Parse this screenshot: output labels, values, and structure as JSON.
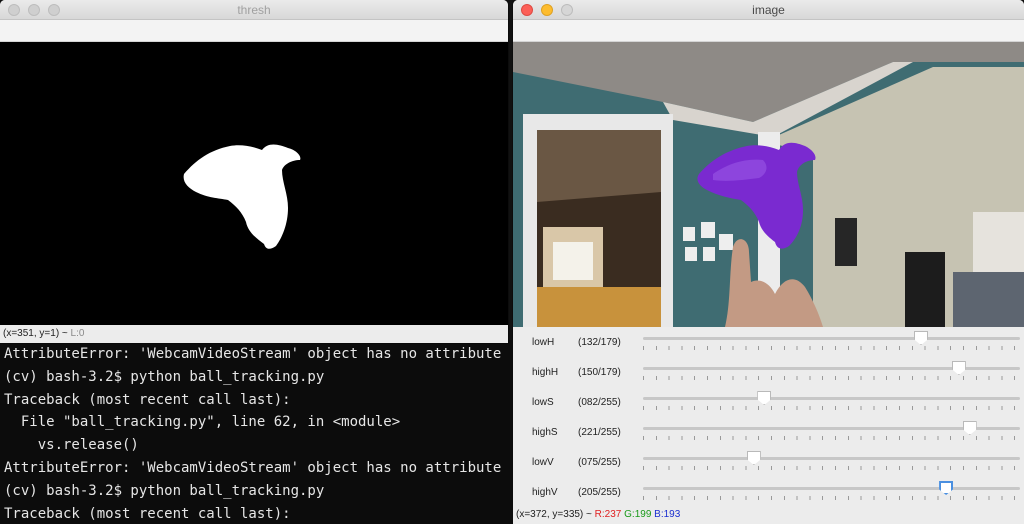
{
  "terminal": {
    "lines": [
      "AttributeError: 'WebcamVideoStream' object has no attribute",
      "(cv) bash-3.2$ python ball_tracking.py",
      "Traceback (most recent call last):",
      "  File \"ball_tracking.py\", line 62, in <module>",
      "    vs.release()",
      "AttributeError: 'WebcamVideoStream' object has no attribute",
      "(cv) bash-3.2$ python ball_tracking.py",
      "Traceback (most recent call last):"
    ]
  },
  "thresh_window": {
    "title": "thresh",
    "status_coords": "(x=351, y=1) ~",
    "status_level": "L:0"
  },
  "image_window": {
    "title": "image",
    "status_coords": "(x=372, y=335) ~",
    "r": "R:237",
    "g": "G:199",
    "b": "B:193",
    "colors": {
      "r": "#e02020",
      "g": "#1a9a1a",
      "b": "#1a2ed0"
    }
  },
  "trackbars": [
    {
      "name": "lowH",
      "value_text": "(132/179)",
      "value": 132,
      "max": 179
    },
    {
      "name": "highH",
      "value_text": "(150/179)",
      "value": 150,
      "max": 179
    },
    {
      "name": "lowS",
      "value_text": "(082/255)",
      "value": 82,
      "max": 255
    },
    {
      "name": "highS",
      "value_text": "(221/255)",
      "value": 221,
      "max": 255
    },
    {
      "name": "lowV",
      "value_text": "(075/255)",
      "value": 75,
      "max": 255
    },
    {
      "name": "highV",
      "value_text": "(205/255)",
      "value": 205,
      "max": 255
    }
  ]
}
